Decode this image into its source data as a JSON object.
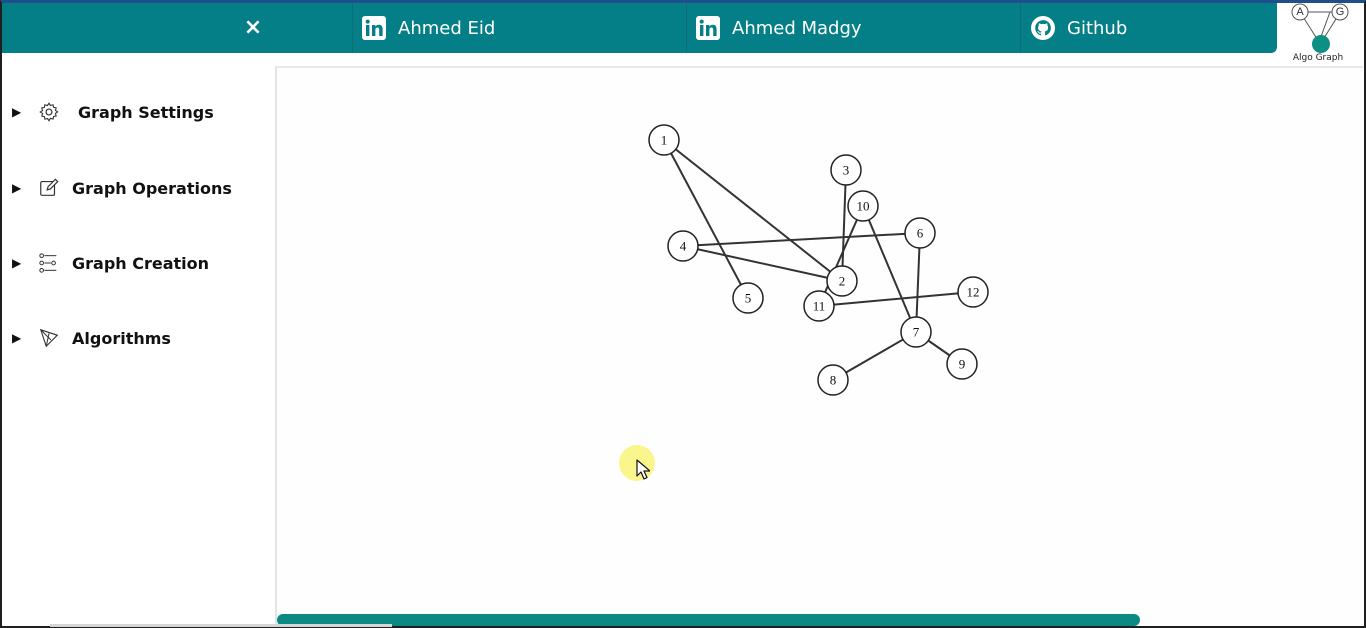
{
  "header": {
    "close_label": "×",
    "links": [
      {
        "label": "Ahmed Eid",
        "icon": "linkedin-icon"
      },
      {
        "label": "Ahmed Madgy",
        "icon": "linkedin-icon"
      },
      {
        "label": "Github",
        "icon": "github-icon"
      }
    ],
    "accent_color": "#047f87"
  },
  "logo": {
    "letters": [
      "A",
      "G"
    ],
    "text": "Algo Graph"
  },
  "sidebar": {
    "items": [
      {
        "label": "Graph Settings",
        "icon": "gear-icon"
      },
      {
        "label": "Graph Operations",
        "icon": "edit-icon"
      },
      {
        "label": "Graph Creation",
        "icon": "graph-creation-icon"
      },
      {
        "label": "Algorithms",
        "icon": "algorithms-icon"
      }
    ]
  },
  "graph": {
    "nodes": [
      {
        "id": "1",
        "label": "1"
      },
      {
        "id": "2",
        "label": "2"
      },
      {
        "id": "3",
        "label": "3"
      },
      {
        "id": "4",
        "label": "4"
      },
      {
        "id": "5",
        "label": "5"
      },
      {
        "id": "6",
        "label": "6"
      },
      {
        "id": "7",
        "label": "7"
      },
      {
        "id": "8",
        "label": "8"
      },
      {
        "id": "9",
        "label": "9"
      },
      {
        "id": "10",
        "label": "10"
      },
      {
        "id": "11",
        "label": "11"
      },
      {
        "id": "12",
        "label": "12"
      }
    ],
    "edges": [
      [
        "1",
        "2"
      ],
      [
        "1",
        "5"
      ],
      [
        "3",
        "2"
      ],
      [
        "4",
        "6"
      ],
      [
        "4",
        "2"
      ],
      [
        "10",
        "11"
      ],
      [
        "10",
        "7"
      ],
      [
        "6",
        "7"
      ],
      [
        "11",
        "12"
      ],
      [
        "7",
        "8"
      ],
      [
        "7",
        "9"
      ]
    ]
  }
}
